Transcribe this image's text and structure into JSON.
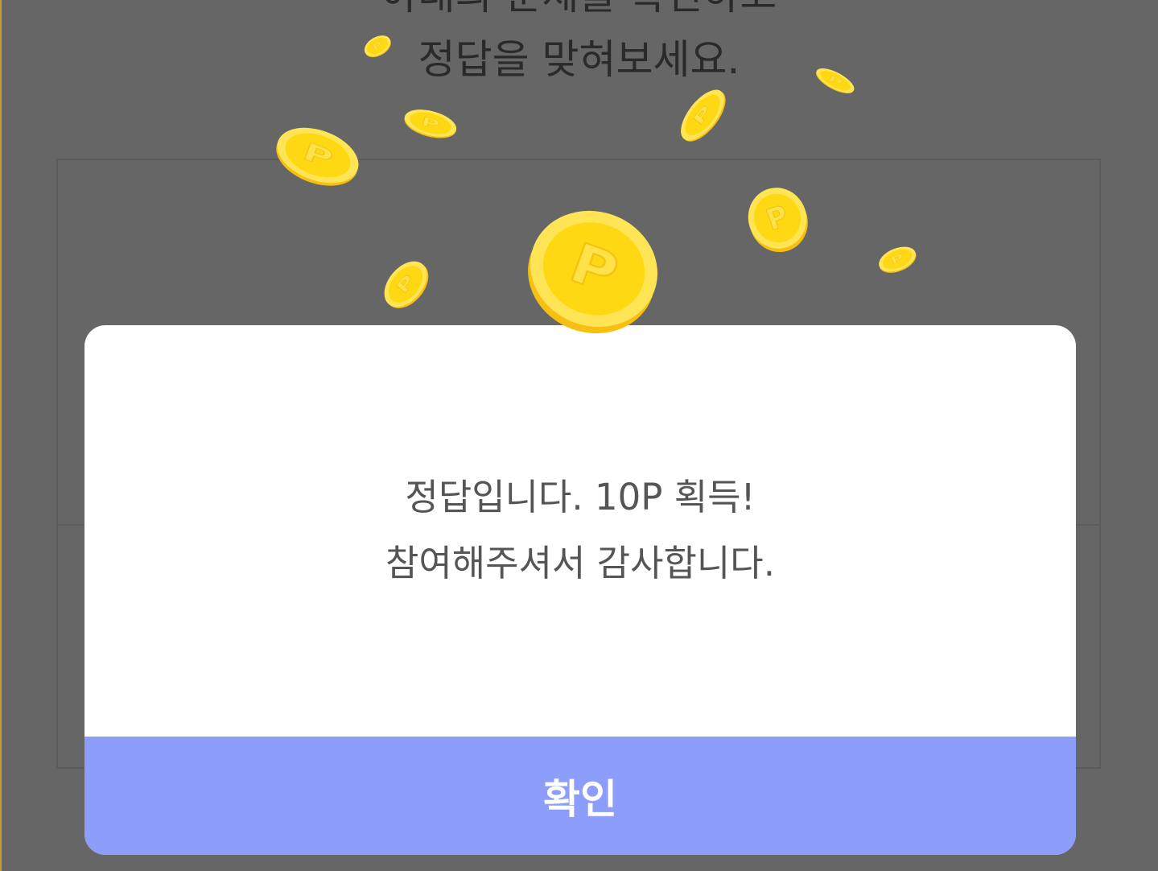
{
  "background": {
    "title_line1": "아래의 문제를 확인하고",
    "title_line2": "정답을 맞혀보세요."
  },
  "coins": {
    "icon": "point-coin-icon",
    "symbol": "P",
    "colors": {
      "face": "#ffd814",
      "rim": "#ffe555",
      "edge": "#f6bf12"
    }
  },
  "modal": {
    "message_line1": "정답입니다. 10P 획득!",
    "message_line2": "참여해주셔서 감사합니다.",
    "confirm_label": "확인"
  },
  "colors": {
    "overlay": "#666666",
    "modal_bg": "#ffffff",
    "button_bg": "#8c9dfa",
    "message_text": "#555555"
  }
}
